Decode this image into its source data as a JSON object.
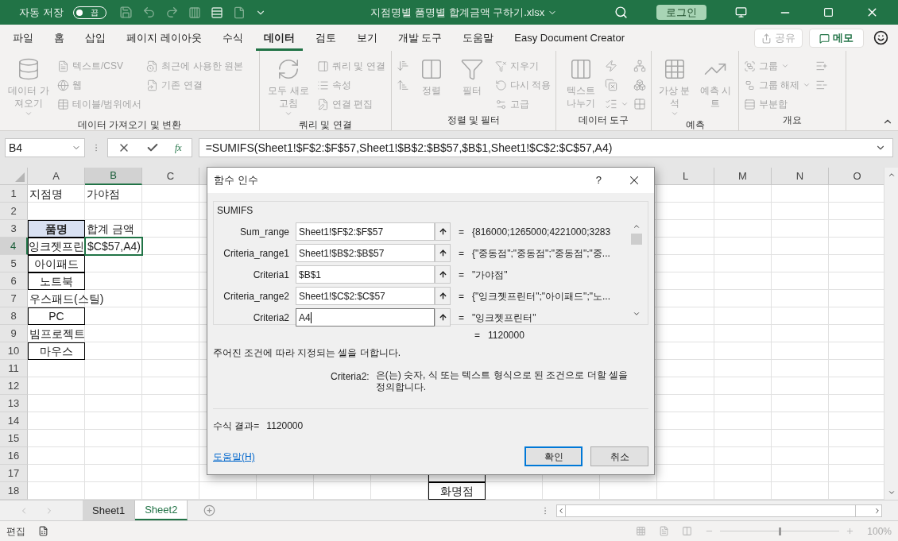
{
  "title_bar": {
    "autosave_label": "자동 저장",
    "autosave_toggle": {
      "label": "끔",
      "on": false
    },
    "title": "지점명별 품명별 합계금액 구하기.xlsx",
    "login": "로그인"
  },
  "menu_tabs": [
    {
      "label": "파일",
      "selected": false
    },
    {
      "label": "홈",
      "selected": false
    },
    {
      "label": "삽입",
      "selected": false
    },
    {
      "label": "페이지 레이아웃",
      "selected": false
    },
    {
      "label": "수식",
      "selected": false
    },
    {
      "label": "데이터",
      "selected": true
    },
    {
      "label": "검토",
      "selected": false
    },
    {
      "label": "보기",
      "selected": false
    },
    {
      "label": "개발 도구",
      "selected": false
    },
    {
      "label": "도움말",
      "selected": false
    },
    {
      "label": "Easy Document Creator",
      "selected": false
    }
  ],
  "share": {
    "label": "공유",
    "disabled": true
  },
  "memo": {
    "label": "메모"
  },
  "ribbon_groups": [
    {
      "label": "데이터 가져오기 및 변환",
      "items": [
        {
          "kind": "large",
          "label": "데이터 가져오기",
          "has_menu": true,
          "disabled": true
        },
        {
          "kind": "small",
          "label": "텍스트/CSV",
          "disabled": true
        },
        {
          "kind": "small",
          "label": "웹",
          "disabled": true
        },
        {
          "kind": "small",
          "label": "테이블/범위에서",
          "disabled": true
        },
        {
          "kind": "small",
          "label": "최근에 사용한 원본",
          "disabled": true
        },
        {
          "kind": "small",
          "label": "기존 연결",
          "disabled": true
        }
      ]
    },
    {
      "label": "쿼리 및 연결",
      "items": [
        {
          "kind": "large",
          "label": "모두 새로 고침",
          "has_menu": true,
          "disabled": true
        },
        {
          "kind": "small",
          "label": "쿼리 및 연결",
          "disabled": true
        },
        {
          "kind": "small",
          "label": "속성",
          "disabled": true
        },
        {
          "kind": "small",
          "label": "연결 편집",
          "disabled": true
        }
      ]
    },
    {
      "label": "정렬 및 필터",
      "items": [
        {
          "kind": "icon",
          "disabled": true
        },
        {
          "kind": "icon",
          "disabled": true
        },
        {
          "kind": "large",
          "label": "정렬",
          "disabled": true
        },
        {
          "kind": "large",
          "label": "필터",
          "disabled": true
        },
        {
          "kind": "small",
          "label": "지우기",
          "disabled": true
        },
        {
          "kind": "small",
          "label": "다시 적용",
          "disabled": true
        },
        {
          "kind": "small",
          "label": "고급",
          "disabled": true
        }
      ]
    },
    {
      "label": "데이터 도구",
      "items": [
        {
          "kind": "large",
          "label": "텍스트 나누기",
          "disabled": true
        },
        {
          "kind": "icon",
          "disabled": true
        },
        {
          "kind": "icon",
          "disabled": true
        },
        {
          "kind": "icon",
          "has_menu": true,
          "disabled": true
        },
        {
          "kind": "icon",
          "disabled": true
        },
        {
          "kind": "icon",
          "disabled": true
        },
        {
          "kind": "icon",
          "disabled": true
        }
      ]
    },
    {
      "label": "예측",
      "items": [
        {
          "kind": "large",
          "label": "가상 분석",
          "has_menu": true,
          "disabled": true
        },
        {
          "kind": "large",
          "label": "예측 시트",
          "disabled": true
        }
      ]
    },
    {
      "label": "개요",
      "items": [
        {
          "kind": "small",
          "label": "그룹",
          "has_menu": true,
          "disabled": true
        },
        {
          "kind": "small",
          "label": "그룹 해제",
          "has_menu": true,
          "disabled": true
        },
        {
          "kind": "small",
          "label": "부분합",
          "disabled": true
        },
        {
          "kind": "icon",
          "disabled": true
        },
        {
          "kind": "icon",
          "disabled": true
        }
      ]
    }
  ],
  "formula_bar": {
    "name_box": "B4",
    "fx": "fx",
    "formula": "=SUMIFS(Sheet1!$F$2:$F$57,Sheet1!$B$2:$B$57,$B$1,Sheet1!$C$2:$C$57,A4)"
  },
  "columns_left": [
    {
      "label": "A",
      "selected": false
    },
    {
      "label": "B",
      "selected": true
    },
    {
      "label": "C",
      "selected": false
    }
  ],
  "columns_right": [
    {
      "label": "L",
      "selected": false
    },
    {
      "label": "M",
      "selected": false
    },
    {
      "label": "N",
      "selected": false
    },
    {
      "label": "O",
      "selected": false
    }
  ],
  "rows": [
    {
      "number": "1",
      "selected": false,
      "cells": [
        {
          "text": "지점명",
          "kind": "text",
          "bordered": false
        },
        {
          "text": "가야점",
          "kind": "text",
          "bordered": false
        }
      ]
    },
    {
      "number": "2",
      "selected": false,
      "cells": []
    },
    {
      "number": "3",
      "selected": false,
      "cells": [
        {
          "text": "품명",
          "kind": "header",
          "bordered": true
        },
        {
          "text": "합계 금액",
          "kind": "text",
          "bordered": false
        }
      ]
    },
    {
      "number": "4",
      "selected": true,
      "cells": [
        {
          "text": "잉크젯프린",
          "kind": "center",
          "bordered": true
        },
        {
          "text": "$C$57,A4)",
          "kind": "editing",
          "bordered": false,
          "selected": true
        }
      ]
    },
    {
      "number": "5",
      "selected": false,
      "cells": [
        {
          "text": "아이패드",
          "kind": "center",
          "bordered": true
        }
      ]
    },
    {
      "number": "6",
      "selected": false,
      "cells": [
        {
          "text": "노트북",
          "kind": "center",
          "bordered": true
        }
      ]
    },
    {
      "number": "7",
      "selected": false,
      "cells": [
        {
          "text": "우스패드(스틸)",
          "kind": "text",
          "bordered": false
        }
      ]
    },
    {
      "number": "8",
      "selected": false,
      "cells": [
        {
          "text": "PC",
          "kind": "center",
          "bordered": true
        }
      ]
    },
    {
      "number": "9",
      "selected": false,
      "cells": [
        {
          "text": "빔프로젝트",
          "kind": "text",
          "bordered": false
        }
      ]
    },
    {
      "number": "10",
      "selected": false,
      "cells": [
        {
          "text": "마우스",
          "kind": "center",
          "bordered": true
        }
      ]
    },
    {
      "number": "11",
      "selected": false,
      "cells": []
    },
    {
      "number": "12",
      "selected": false,
      "cells": []
    },
    {
      "number": "13",
      "selected": false,
      "cells": []
    },
    {
      "number": "14",
      "selected": false,
      "cells": []
    },
    {
      "number": "15",
      "selected": false,
      "cells": []
    },
    {
      "number": "16",
      "selected": false,
      "cells": []
    },
    {
      "number": "17",
      "selected": false,
      "cells": [],
      "cells_from_h": [
        {
          "bordered": true
        }
      ]
    },
    {
      "number": "18",
      "selected": false,
      "cells": [],
      "cells_from_h": [
        {
          "text": "화명점",
          "kind": "center",
          "bordered": true
        }
      ]
    }
  ],
  "dialog": {
    "title": "함수 인수",
    "help_button": "?",
    "function_name": "SUMIFS",
    "arguments": [
      {
        "name": "Sum_range",
        "value": "Sheet1!$F$2:$F$57",
        "result": "{816000;1265000;4221000;3283",
        "focused": false
      },
      {
        "name": "Criteria_range1",
        "value": "Sheet1!$B$2:$B$57",
        "result": "{\"중동점\";\"중동점\";\"중동점\";\"중...",
        "focused": false
      },
      {
        "name": "Criteria1",
        "value": "$B$1",
        "result": "\"가야점\"",
        "focused": false
      },
      {
        "name": "Criteria_range2",
        "value": "Sheet1!$C$2:$C$57",
        "result": "{\"잉크젯프린터\";\"아이패드\";\"노...",
        "focused": false
      },
      {
        "name": "Criteria2",
        "value": "A4",
        "result": "\"잉크젯프린터\"",
        "focused": true
      }
    ],
    "equals": "=",
    "total": "1120000",
    "description": "주어진 조건에 따라 지정되는 셀을 더합니다.",
    "arg_help_name": "Criteria2:",
    "arg_help_text": "은(는) 숫자, 식 또는 텍스트 형식으로 된 조건으로 더할 셀을 정의합니다.",
    "result_label": "수식 결과=",
    "result_value": "1120000",
    "help_link": "도움말(H)",
    "buttons": [
      {
        "label": "확인",
        "default": true
      },
      {
        "label": "취소",
        "default": false
      }
    ]
  },
  "sheet_tabs": [
    {
      "label": "Sheet1",
      "selected": false
    },
    {
      "label": "Sheet2",
      "selected": true
    }
  ],
  "status_bar": {
    "mode": "편집",
    "zoom_slider": {
      "level": 0.5
    },
    "zoom": "100%"
  }
}
